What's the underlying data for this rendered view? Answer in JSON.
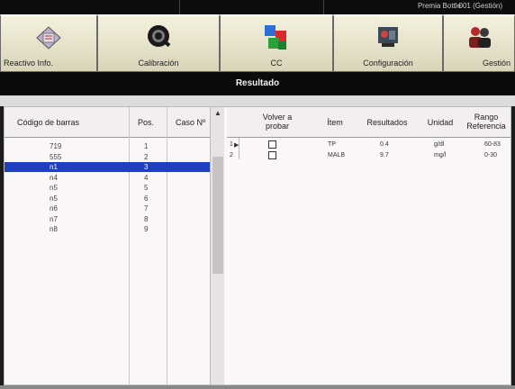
{
  "statusbar": {
    "info": "Premia Bottle",
    "mode": "001 (Gestión)"
  },
  "toolbar": {
    "buttons": [
      {
        "label": "Reactivo Info.",
        "icon": "reagent-icon"
      },
      {
        "label": "Calibración",
        "icon": "calibration-icon"
      },
      {
        "label": "CC",
        "icon": "qc-cubes-icon"
      },
      {
        "label": "Configuración",
        "icon": "settings-tools-icon"
      },
      {
        "label": "Gestión",
        "icon": "users-icon"
      }
    ]
  },
  "title": "Resultado",
  "left_table": {
    "columns": [
      "Código de barras",
      "Pos.",
      "Caso Nº"
    ],
    "rows": [
      {
        "barcode": "719",
        "pos": "1",
        "case": ""
      },
      {
        "barcode": "555",
        "pos": "2",
        "case": ""
      },
      {
        "barcode": "n1",
        "pos": "3",
        "case": "",
        "selected": true
      },
      {
        "barcode": "n4",
        "pos": "4",
        "case": ""
      },
      {
        "barcode": "n5",
        "pos": "5",
        "case": ""
      },
      {
        "barcode": "n5",
        "pos": "6",
        "case": ""
      },
      {
        "barcode": "n6",
        "pos": "7",
        "case": ""
      },
      {
        "barcode": "n7",
        "pos": "8",
        "case": ""
      },
      {
        "barcode": "n8",
        "pos": "9",
        "case": ""
      }
    ]
  },
  "right_table": {
    "columns": [
      "Volver a probar",
      "Ítem",
      "Resultados",
      "Unidad",
      "Rango Referencia"
    ],
    "rows": [
      {
        "idx": "1",
        "retest": false,
        "item": "TP",
        "result": "0.4",
        "unit": "g/dl",
        "range": "60-83"
      },
      {
        "idx": "2",
        "retest": false,
        "item": "MALB",
        "result": "9.7",
        "unit": "mg/l",
        "range": "0-30"
      }
    ]
  },
  "colors": {
    "selection": "#1f3fbf",
    "titlebar": "#0b0b0b",
    "panel_bg": "#fbf7f7"
  }
}
